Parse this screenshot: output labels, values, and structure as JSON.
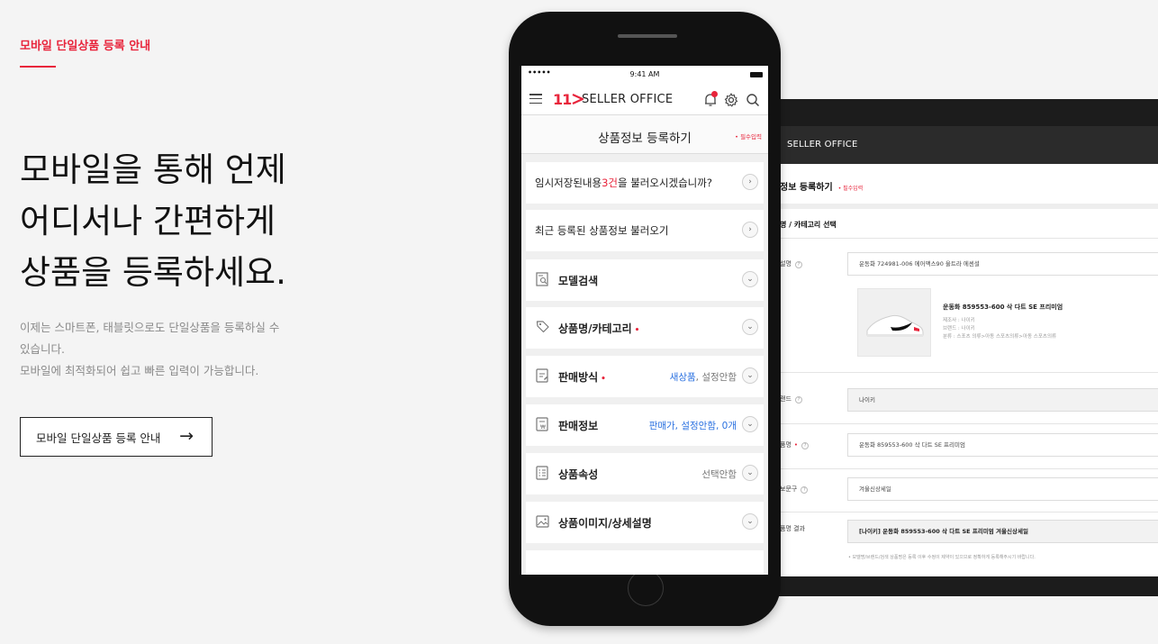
{
  "promo": {
    "eyebrow": "모바일 단일상품 등록 안내",
    "headline": [
      "모바일을 통해 언제",
      "어디서나 간편하게",
      "상품을 등록하세요."
    ],
    "description": [
      "이제는 스마트폰, 태블릿으로도 단일상품을 등록하실 수",
      "있습니다.",
      "모바일에 최적화되어 쉽고 빠른 입력이 가능합니다."
    ],
    "cta_label": "모바일 단일상품 등록 안내",
    "cta_arrow": "→"
  },
  "colors": {
    "accent": "#e8243b",
    "link_blue": "#2970e0"
  },
  "phone": {
    "status": {
      "signal": "•••••",
      "time": "9:41 AM"
    },
    "app": {
      "logo": "11",
      "brand": "SELLER OFFICE",
      "icons": [
        "menu-icon",
        "bell-icon",
        "gear-icon",
        "search-icon"
      ]
    },
    "page_title": "상품정보 등록하기",
    "required_note": "• 필수입력",
    "temp_saved": {
      "pre": "임시저장된내용",
      "count": "3건",
      "post": "을 불러오시겠습니까?"
    },
    "recent_load": "최근 등록된 상품정보 불러오기",
    "sections": [
      {
        "label": "모델검색",
        "required": false,
        "value": "",
        "icon": "model-search-icon"
      },
      {
        "label": "상품명/카테고리",
        "required": true,
        "value": "",
        "icon": "tag-icon"
      },
      {
        "label": "판매방식",
        "required": true,
        "value_blue": "새상품",
        "value_grey": ", 설정안함",
        "icon": "sale-method-icon"
      },
      {
        "label": "판매정보",
        "required": false,
        "value_blue": "판매가, 설정안함, 0개",
        "value_grey": "",
        "icon": "sale-info-icon"
      },
      {
        "label": "상품속성",
        "required": false,
        "value_grey": "선택안함",
        "icon": "attribute-icon"
      },
      {
        "label": "상품이미지/상세설명",
        "required": false,
        "value": "",
        "icon": "image-icon"
      }
    ],
    "required_dot": "•",
    "chevron_right": "›",
    "chevron_down": "⌄"
  },
  "tablet": {
    "brand": "SELLER OFFICE",
    "title": "정보 등록하기",
    "required_note": "• 필수입력",
    "section": "명 / 카테고리 선택",
    "rows": [
      {
        "label": "설명",
        "value": "운동화 724981-006 에어맥스90 울트라 에센셜"
      },
      {
        "label": "랜드",
        "value": "나이키"
      },
      {
        "label": "품명",
        "value": "운동화 859553-600 삭 다트 SE 프리미엄"
      },
      {
        "label": "보문구",
        "value": "겨울신상세일"
      },
      {
        "label": "품명 결과",
        "value": "[나이키] 운동화 859553-600 삭 다트 SE 프리미엄 겨울신상세일"
      }
    ],
    "help_mark": "?",
    "product": {
      "name": "운동화 859553-600 삭 다트 SE 프리미엄",
      "meta": [
        "제조사 : 나이키",
        "브랜드 : 나이키",
        "분류 : 스포츠 의류>아동 스포츠의류>아동 스포츠의류"
      ]
    },
    "note": "• 모델명/브랜드/검색 상품명은 등록 이후 수정이 제약이 있으므로 정확하게 등록해주시기 바랍니다."
  }
}
